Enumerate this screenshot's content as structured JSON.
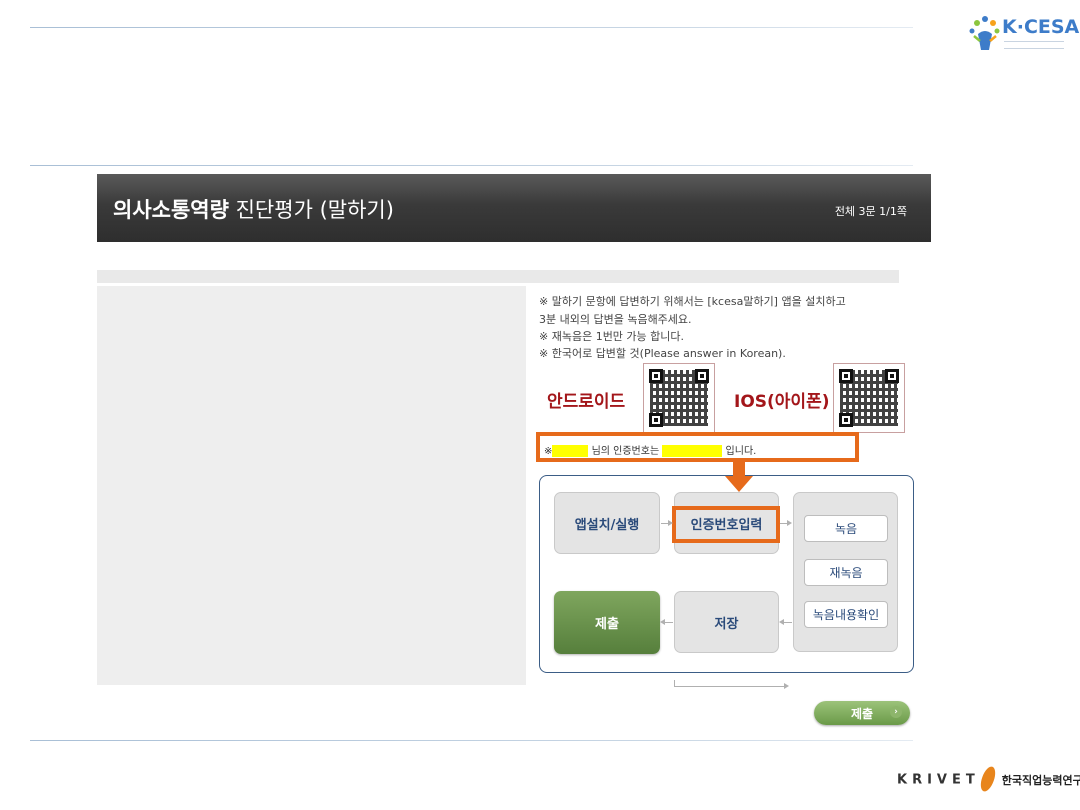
{
  "branding": {
    "top_logo": "K·CESA",
    "footer_logo_latin": "KRIVET",
    "footer_logo_korean": "한국직업능력연구원"
  },
  "header": {
    "title_bold": "의사소통역량",
    "title_light": "진단평가 (말하기)",
    "count": "전체 3문 1/1쪽"
  },
  "instructions": [
    "※ 말하기 문항에 답변하기 위해서는 [kcesa말하기] 앱을 설치하고",
    "3분 내외의 답변을 녹음해주세요.",
    "※ 재녹음은 1번만 가능 합니다.",
    "※ 한국어로 답변할 것(Please answer in Korean)."
  ],
  "qr": {
    "android_label": "안드로이드",
    "ios_label": "IOS(아이폰)"
  },
  "auth": {
    "prefix": "※",
    "mid": "님의 인증번호는",
    "suffix": "입니다."
  },
  "flow": {
    "install": "앱설치/실행",
    "auth_input": "인증번호입력",
    "record": "녹음",
    "rerecord": "재녹음",
    "confirm": "녹음내용확인",
    "save": "저장",
    "submit": "제출"
  },
  "submit_button": {
    "label": "제출",
    "chevron": "›"
  },
  "colors": {
    "accent_orange": "#e66a1b",
    "submit_green": "#6a9a48",
    "qr_label_red": "#a3161a",
    "flow_text_blue": "#2a4a7a"
  }
}
